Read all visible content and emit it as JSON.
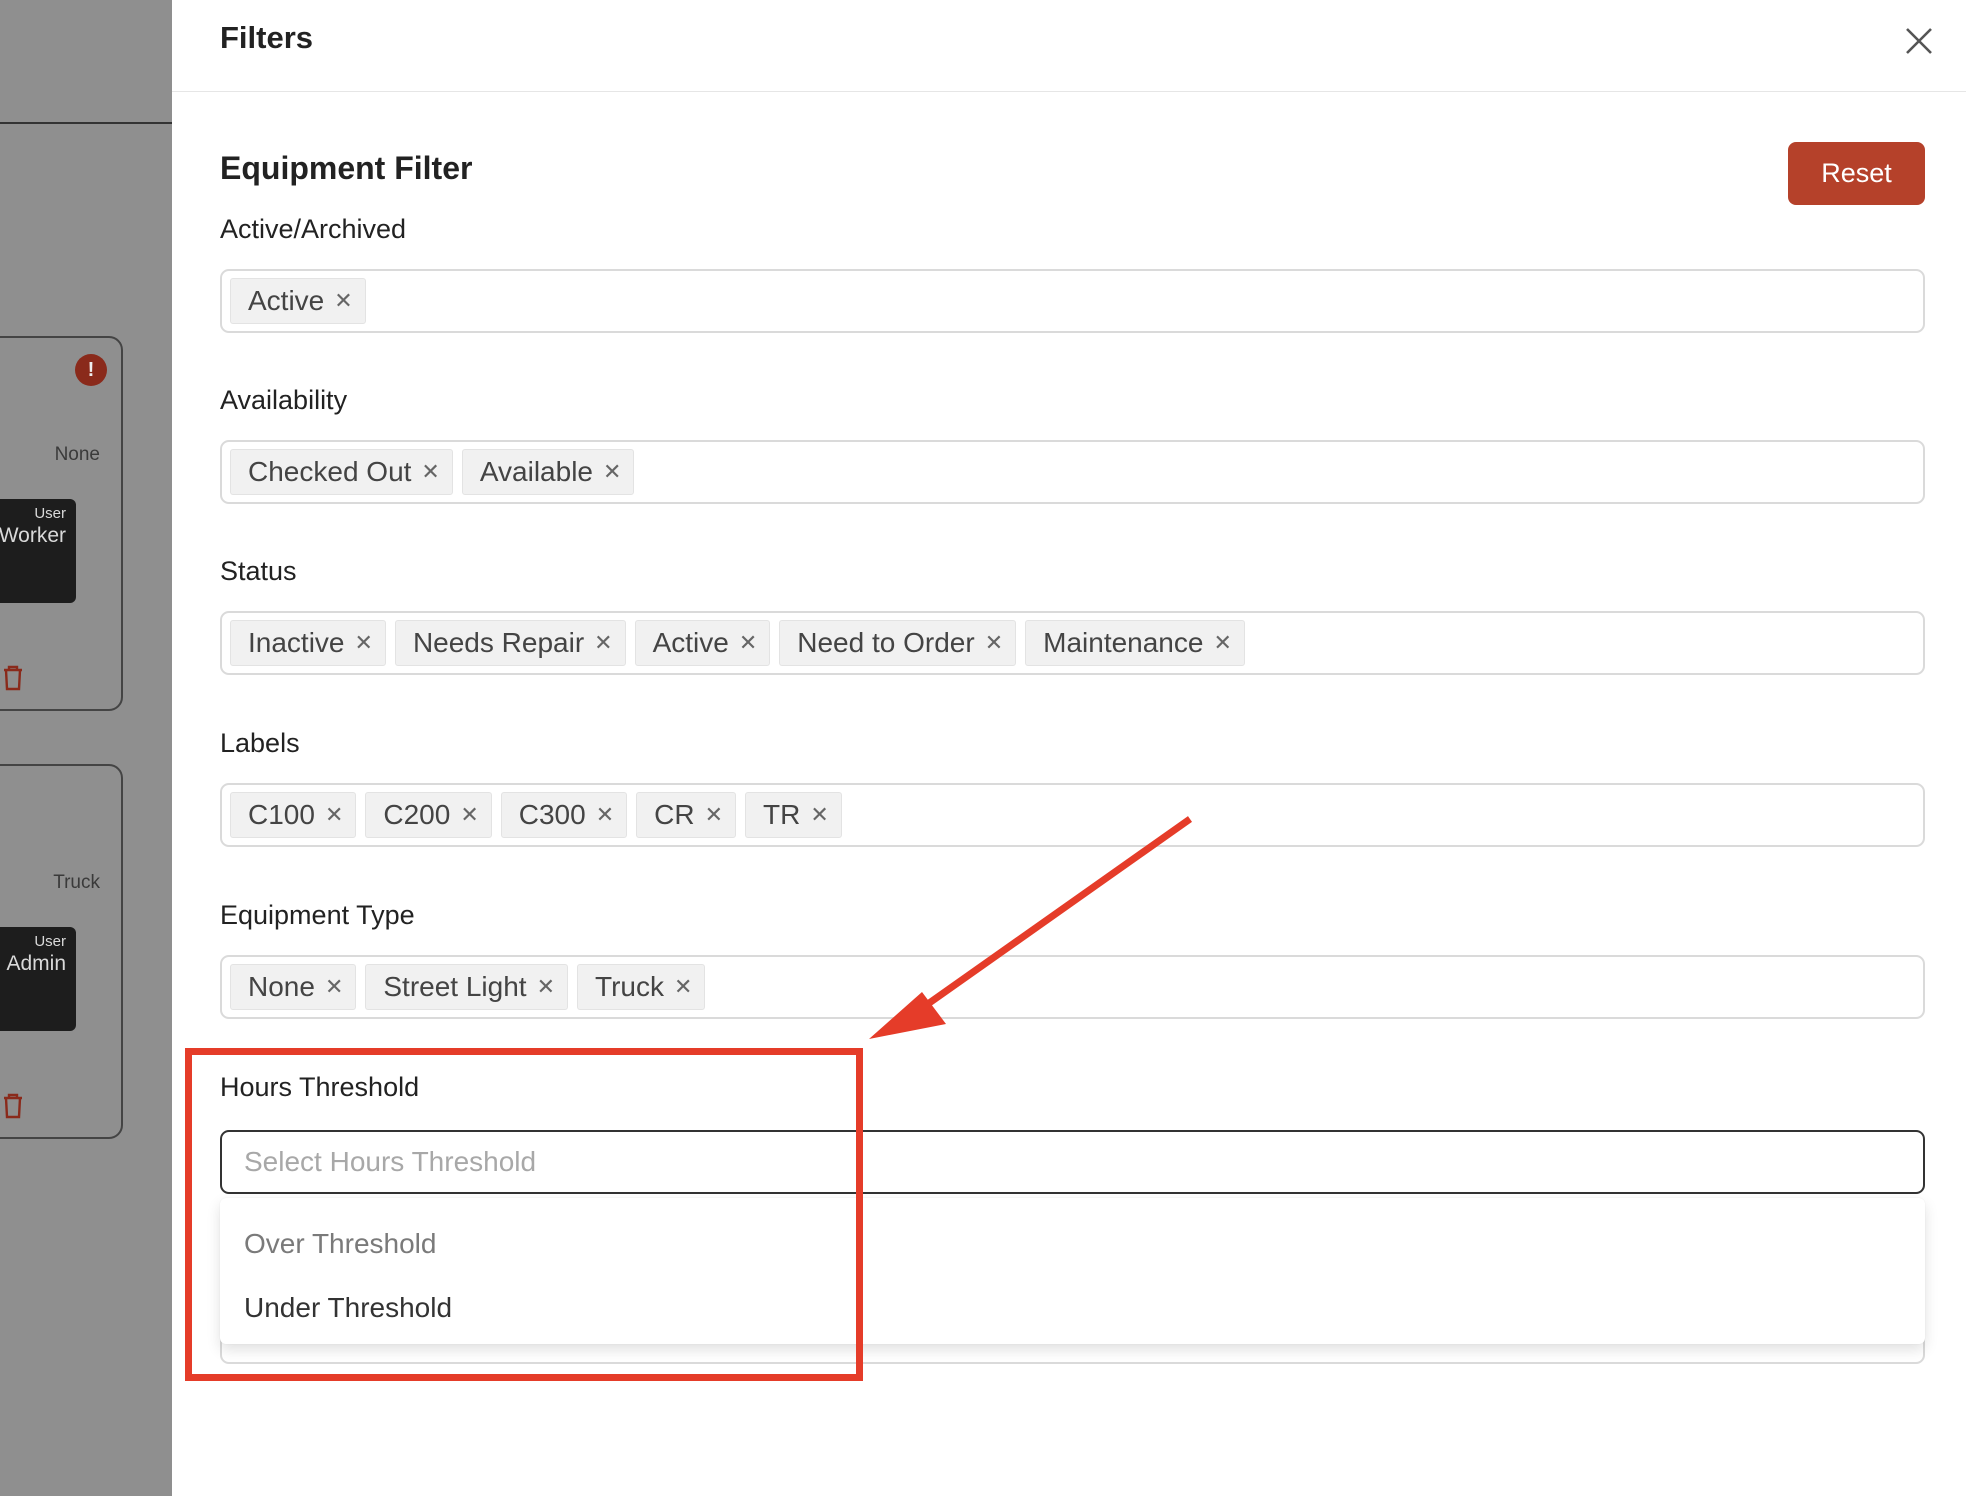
{
  "background": {
    "cards": [
      {
        "type": "None",
        "user_small": "User",
        "user_name": "Worker"
      },
      {
        "type": "Truck",
        "user_small": "User",
        "user_name": "Admin"
      }
    ],
    "alert_glyph": "!"
  },
  "drawer": {
    "title": "Filters",
    "close_icon": "close-icon",
    "section_title": "Equipment Filter",
    "reset_label": "Reset",
    "reset_color": "#b5412a"
  },
  "filters": {
    "active_archived": {
      "label": "Active/Archived",
      "tags": [
        "Active"
      ]
    },
    "availability": {
      "label": "Availability",
      "tags": [
        "Checked Out",
        "Available"
      ]
    },
    "status": {
      "label": "Status",
      "tags": [
        "Inactive",
        "Needs Repair",
        "Active",
        "Need to Order",
        "Maintenance"
      ]
    },
    "labels": {
      "label": "Labels",
      "tags": [
        "C100",
        "C200",
        "C300",
        "CR",
        "TR"
      ]
    },
    "equipment_type": {
      "label": "Equipment Type",
      "tags": [
        "None",
        "Street Light",
        "Truck"
      ]
    },
    "hours_threshold": {
      "label": "Hours Threshold",
      "placeholder": "Select Hours Threshold",
      "options": [
        "Over Threshold",
        "Under Threshold"
      ]
    }
  },
  "annotation": {
    "color": "#e53c29"
  }
}
